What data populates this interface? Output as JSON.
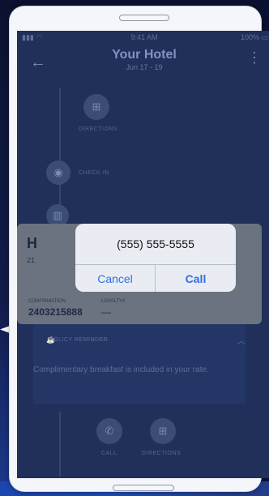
{
  "status": {
    "time": "9:41 AM",
    "battery": "100%"
  },
  "header": {
    "title": "Your Hotel",
    "subtitle": "Jun 17 - 19"
  },
  "timeline": {
    "directions_top": "DIRECTIONS",
    "checkin": "CHECK-IN",
    "call": "CALL",
    "directions_bottom": "DIRECTIONS"
  },
  "card": {
    "hotel_initial": "H",
    "address_partial": "21",
    "confirmation_label": "CONFIRMATION",
    "confirmation_value": "2403215888",
    "loyalty_label": "LOYALTY#",
    "loyalty_value": "—"
  },
  "policy": {
    "label": "POLICY REMINDER",
    "text": "Complimentary breakfast is included in your rate."
  },
  "dialog": {
    "phone": "(555) 555-5555",
    "cancel": "Cancel",
    "call": "Call"
  }
}
